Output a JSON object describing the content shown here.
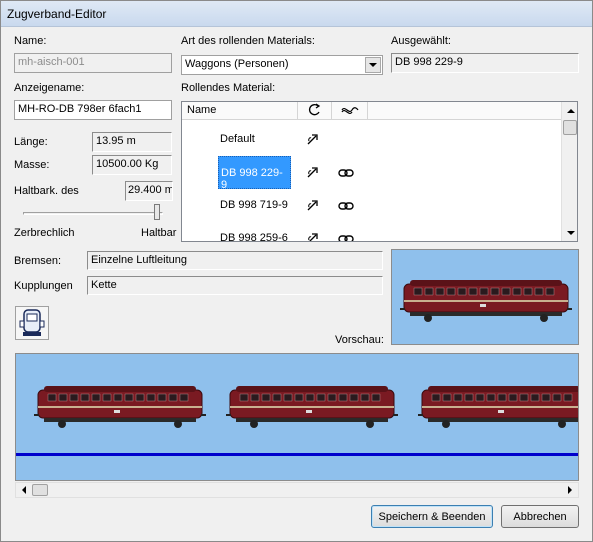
{
  "window": {
    "title": "Zugverband-Editor"
  },
  "labels": {
    "name": "Name:",
    "material_type": "Art des rollenden Materials:",
    "selected": "Ausgewählt:",
    "display_name": "Anzeigename:",
    "rolling_material": "Rollendes Material:",
    "length": "Länge:",
    "mass": "Masse:",
    "durability": "Haltbark. des",
    "fragile": "Zerbrechlich",
    "durable": "Haltbar",
    "brakes": "Bremsen:",
    "couplings": "Kupplungen",
    "preview": "Vorschau:"
  },
  "fields": {
    "name": "mh-aisch-001",
    "material_type": "Waggons (Personen)",
    "selected": "DB 998 229-9",
    "display_name": "MH-RO-DB 798er 6fach1",
    "length": "13.95 m",
    "mass": "10500.00 Kg",
    "durability": "29.400 m",
    "brakes": "Einzelne Luftleitung",
    "couplings": "Kette"
  },
  "durability_slider": {
    "value": 0.96
  },
  "list": {
    "columns": [
      "Name",
      "",
      ""
    ],
    "column_icons": [
      "",
      "rotate-icon",
      "coupling-icon"
    ],
    "rows": [
      {
        "name": "Default",
        "selected": false,
        "has_coupling": false
      },
      {
        "name": "DB 998 229-9",
        "selected": true,
        "has_coupling": true
      },
      {
        "name": "DB 998 719-9",
        "selected": false,
        "has_coupling": true
      },
      {
        "name": "DB 998 259-6",
        "selected": false,
        "has_coupling": true
      }
    ]
  },
  "buttons": {
    "save": "Speichern & Beenden",
    "cancel": "Abbrechen"
  },
  "colors": {
    "selection": "#3399ff",
    "preview_bg": "#8fc0ec",
    "train_body": "#7a1a22",
    "track_line": "#0000cc"
  },
  "icons": {
    "reverse": "arrow-reverse-icon",
    "coupling": "chain-link-icon",
    "locomotive": "locomotive-front-icon"
  },
  "train_strip": {
    "car_count": 3
  }
}
